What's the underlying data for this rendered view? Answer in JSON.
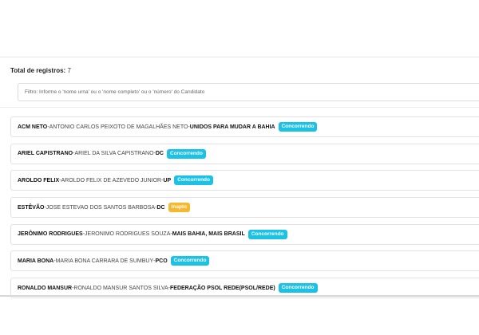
{
  "summary": {
    "total_label": "Total de registros:",
    "total_value": "7"
  },
  "filter": {
    "placeholder": "Filtro: Informe o 'nome urna' ou o 'nome completo' ou o 'número' do Candidato",
    "value": ""
  },
  "separator": " - ",
  "colors": {
    "concorrendo": "#1cc1e6",
    "inapto": "#f5b82e"
  },
  "candidates": [
    {
      "urna": "ACM NETO",
      "full": "ANTONIO CARLOS PEIXOTO DE MAGALHÃES NETO",
      "party": "UNIDOS PARA MUDAR A BAHIA",
      "status": "Concorrendo",
      "status_type": "ok"
    },
    {
      "urna": "ARIEL CAPISTRANO",
      "full": "ARIEL DA SILVA CAPISTRANO",
      "party": "DC",
      "status": "Concorrendo",
      "status_type": "ok"
    },
    {
      "urna": "AROLDO FELIX",
      "full": "AROLDO FELIX DE AZEVEDO JUNIOR",
      "party": "UP",
      "status": "Concorrendo",
      "status_type": "ok"
    },
    {
      "urna": "ESTÊVÃO",
      "full": "JOSE ESTEVAO DOS SANTOS BARBOSA",
      "party": "DC",
      "status": "Inapto",
      "status_type": "bad"
    },
    {
      "urna": "JERÔNIMO RODRIGUES",
      "full": "JERONIMO RODRIGUES SOUZA",
      "party": "MAIS BAHIA, MAIS BRASIL",
      "status": "Concorrendo",
      "status_type": "ok"
    },
    {
      "urna": "MARIA BONA",
      "full": "MARIA BONA CARRARA DE SUMBUY",
      "party": "PCO",
      "status": "Concorrendo",
      "status_type": "ok"
    },
    {
      "urna": "RONALDO MANSUR",
      "full": "RONALDO MANSUR SANTOS SILVA",
      "party": "FEDERAÇÃO PSOL REDE(PSOL/REDE)",
      "status": "Concorrendo",
      "status_type": "ok"
    }
  ]
}
